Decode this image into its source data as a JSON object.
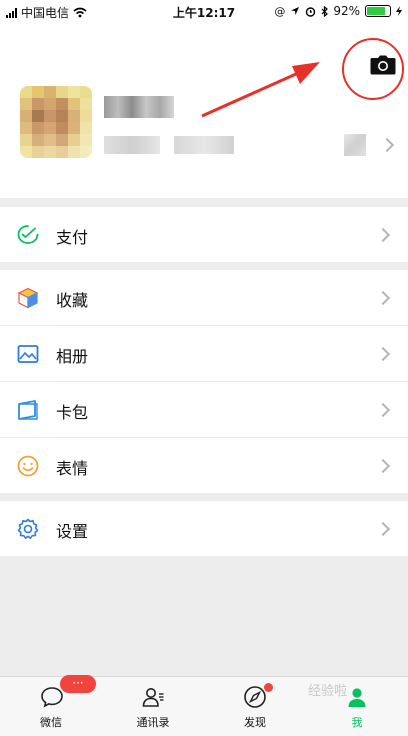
{
  "status_bar": {
    "carrier": "中国电信",
    "time": "上午12:17",
    "battery": "92%",
    "battery_level": 0.92
  },
  "profile": {
    "camera_icon": "camera-icon",
    "annotation_color": "#e8302a"
  },
  "menu": {
    "pay": {
      "label": "支付",
      "icon": "wechat-pay-icon"
    },
    "favorites": {
      "label": "收藏",
      "icon": "cube-icon"
    },
    "album": {
      "label": "相册",
      "icon": "image-icon"
    },
    "cards": {
      "label": "卡包",
      "icon": "card-icon"
    },
    "stickers": {
      "label": "表情",
      "icon": "smile-icon"
    },
    "settings": {
      "label": "设置",
      "icon": "gear-icon"
    }
  },
  "tabbar": {
    "tabs": [
      {
        "label": "微信",
        "badge": "···"
      },
      {
        "label": "通讯录"
      },
      {
        "label": "发现"
      },
      {
        "label": "我"
      }
    ],
    "active_color": "#07c160"
  },
  "watermark": "经验啦"
}
